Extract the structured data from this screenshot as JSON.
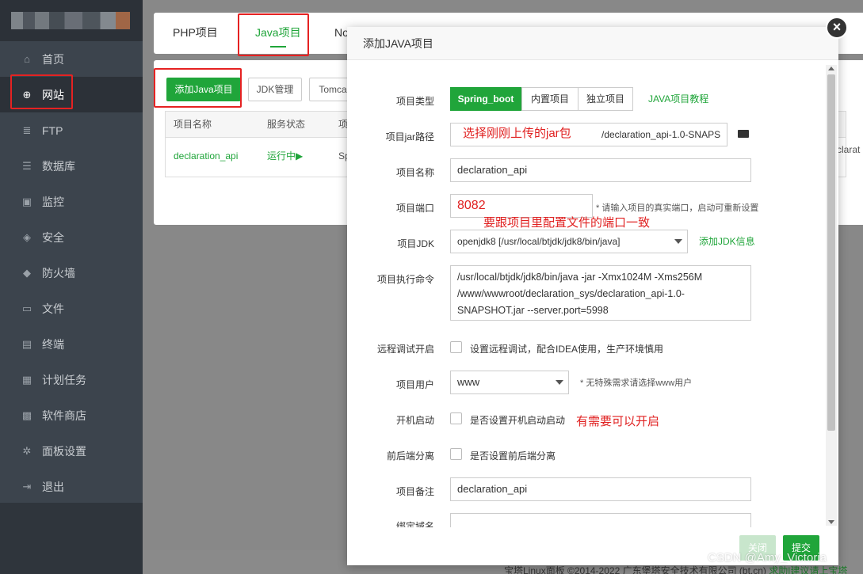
{
  "sidebar": {
    "items": [
      {
        "label": "首页",
        "icon": "home-icon",
        "glyph": "⌂"
      },
      {
        "label": "网站",
        "icon": "globe-icon",
        "glyph": "⊕"
      },
      {
        "label": "FTP",
        "icon": "ftp-icon",
        "glyph": "≣"
      },
      {
        "label": "数据库",
        "icon": "database-icon",
        "glyph": "☰"
      },
      {
        "label": "监控",
        "icon": "monitor-icon",
        "glyph": "▣"
      },
      {
        "label": "安全",
        "icon": "shield-icon",
        "glyph": "◈"
      },
      {
        "label": "防火墙",
        "icon": "firewall-icon",
        "glyph": "◆"
      },
      {
        "label": "文件",
        "icon": "folder-icon",
        "glyph": "▭"
      },
      {
        "label": "终端",
        "icon": "terminal-icon",
        "glyph": "▤"
      },
      {
        "label": "计划任务",
        "icon": "calendar-icon",
        "glyph": "▦"
      },
      {
        "label": "软件商店",
        "icon": "grid-icon",
        "glyph": "▩"
      },
      {
        "label": "面板设置",
        "icon": "gear-icon",
        "glyph": "✲"
      },
      {
        "label": "退出",
        "icon": "logout-icon",
        "glyph": "⇥"
      }
    ],
    "active_index": 1
  },
  "tabs": {
    "php": "PHP项目",
    "java": "Java项目",
    "node": "No"
  },
  "toolbar": {
    "add_java": "添加Java项目",
    "jdk": "JDK管理",
    "tomcat": "Tomca"
  },
  "table": {
    "headers": [
      "项目名称",
      "服务状态",
      "项"
    ],
    "row": {
      "name": "declaration_api",
      "status": "运行中▶",
      "type": "Sp",
      "right": "clarat"
    }
  },
  "footer": {
    "copyright": "宝塔Linux面板 ©2014-2022 广东堡塔安全技术有限公司 (bt.cn)",
    "link": "求助|建议请上宝塔"
  },
  "modal": {
    "title": "添加JAVA项目",
    "type_label": "项目类型",
    "types": [
      "Spring_boot",
      "内置项目",
      "独立项目"
    ],
    "tutorial_link": "JAVA项目教程",
    "jar_label": "项目jar路径",
    "jar_value": "/declaration_api-1.0-SNAPS",
    "jar_note": "选择刚刚上传的jar包",
    "name_label": "项目名称",
    "name_value": "declaration_api",
    "port_label": "项目端口",
    "port_value": "8082",
    "port_hint": "* 请输入项目的真实端口，启动可重新设置",
    "port_note": "要跟项目里配置文件的端口一致",
    "jdk_label": "项目JDK",
    "jdk_value": "openjdk8 [/usr/local/btjdk/jdk8/bin/java]",
    "jdk_link": "添加JDK信息",
    "cmd_label": "项目执行命令",
    "cmd_lines": [
      "/usr/local/btjdk/jdk8/bin/java -jar -Xmx1024M -Xms256M",
      "/www/wwwroot/declaration_sys/declaration_api-1.0-",
      "SNAPSHOT.jar --server.port=5998"
    ],
    "debug_label": "远程调试开启",
    "debug_text": "设置远程调试，配合IDEA使用，生产环境慎用",
    "user_label": "项目用户",
    "user_value": "www",
    "user_hint": "* 无特殊需求请选择www用户",
    "boot_label": "开机启动",
    "boot_text": "是否设置开机启动启动",
    "boot_note": "有需要可以开启",
    "split_label": "前后端分离",
    "split_text": "是否设置前后端分离",
    "remark_label": "项目备注",
    "remark_value": "declaration_api",
    "domain_label": "绑定域名",
    "close_btn": "关闭",
    "submit_btn": "提交"
  },
  "watermark": "CSDN @Amy_Victoria",
  "colors": {
    "accent": "#20a53a",
    "annotation": "#e52222",
    "sidebar": "#3c444d"
  }
}
